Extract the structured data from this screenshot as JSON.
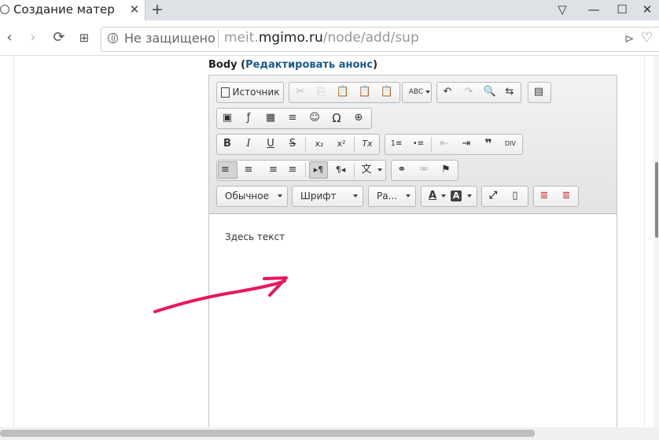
{
  "tab": {
    "title": "Создание матер",
    "close": "✕"
  },
  "new_tab": "+",
  "window": {
    "tabs_menu": "▽",
    "minimize": "—",
    "maximize": "☐",
    "close": "✕"
  },
  "nav": {
    "back": "‹",
    "forward": "›",
    "reload": "⟳",
    "apps": "⊞"
  },
  "omnibox": {
    "security_text": "Не защищено",
    "url_prefix": "meit.",
    "url_domain": "mgimo.ru",
    "url_path": "/node/add/sup",
    "send_icon": "⊳",
    "bookmark_icon": "♡"
  },
  "field": {
    "label": "Body",
    "link": "Редактировать анонс",
    "open": " (",
    "close": ")"
  },
  "toolbar": {
    "source_label": "Источник",
    "format_combo": "Обычное",
    "font_combo": "Шрифт",
    "size_combo": "Ра...",
    "glyphs": {
      "cut": "✂",
      "copy": "⎘",
      "paste": "📋",
      "paste_text": "📋",
      "paste_word": "📋",
      "spellcheck": "ABC",
      "undo": "↶",
      "redo": "↷",
      "find": "🔍",
      "replace": "⇆",
      "select_all": "▤",
      "image": "▣",
      "flash": "ƒ",
      "table": "▦",
      "hr": "≡",
      "smiley": "☺",
      "special_char": "Ω",
      "iframe": "⊕",
      "bold": "B",
      "italic": "I",
      "underline": "U",
      "strike": "S",
      "subscript": "x₂",
      "superscript": "x²",
      "remove_format": "Tx",
      "numbered_list": "1≡",
      "bulleted_list": "•≡",
      "outdent": "⇤",
      "indent": "⇥",
      "blockquote": "❞",
      "div": "DIV",
      "align_left": "≡",
      "align_center": "≡",
      "align_right": "≡",
      "justify": "≡",
      "ltr": "▸¶",
      "rtl": "¶◂",
      "language": "文",
      "link": "⚭",
      "unlink": "⚮",
      "anchor": "⚑",
      "text_color": "A",
      "bg_color": "A",
      "maximize": "⤢",
      "show_blocks": "▯",
      "templates": "≣",
      "source_code": "≣"
    }
  },
  "editor": {
    "content": "Здесь текст"
  },
  "colors": {
    "annotation": "#e8175d",
    "link": "#1a5a8a"
  }
}
